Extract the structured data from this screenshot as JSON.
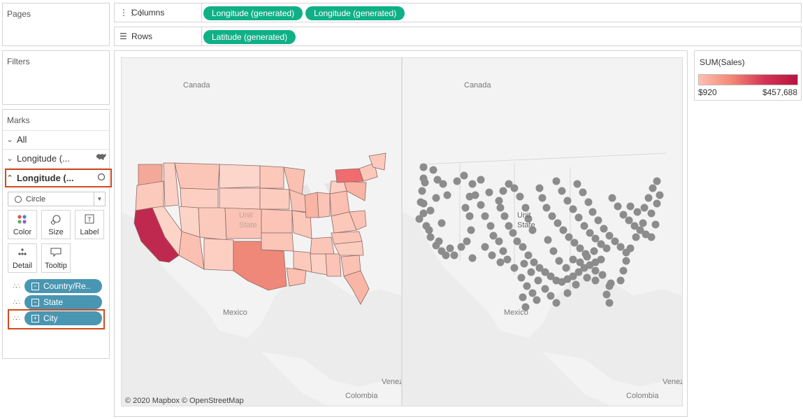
{
  "pages": {
    "title": "Pages"
  },
  "filters": {
    "title": "Filters"
  },
  "marks": {
    "title": "Marks",
    "all_label": "All",
    "layer1_label": "Longitude (...",
    "layer2_label": "Longitude (...",
    "mark_type": "Circle",
    "buttons": {
      "color": "Color",
      "size": "Size",
      "label": "Label",
      "detail": "Detail",
      "tooltip": "Tooltip"
    },
    "fields": [
      "Country/Re..",
      "State",
      "City"
    ]
  },
  "shelves": {
    "columns_label": "Columns",
    "columns_pills": [
      "Longitude (generated)",
      "Longitude (generated)"
    ],
    "rows_label": "Rows",
    "rows_pills": [
      "Latitude (generated)"
    ]
  },
  "map": {
    "labels": {
      "canada": "Canada",
      "mexico": "Mexico",
      "us1": "Unit",
      "us2": "State",
      "colombia": "Colombia",
      "venezuela": "Venez"
    },
    "attribution": "© 2020 Mapbox © OpenStreetMap"
  },
  "legend": {
    "title": "SUM(Sales)",
    "min": "$920",
    "max": "$457,688"
  },
  "colors": {
    "green_pill": "#10b087",
    "blue_pill": "#4996b2",
    "highlight": "#d04a1d",
    "high_sales": "#b9123f",
    "low_sales": "#ffc0b0",
    "city_dot": "#8c8c8c"
  }
}
